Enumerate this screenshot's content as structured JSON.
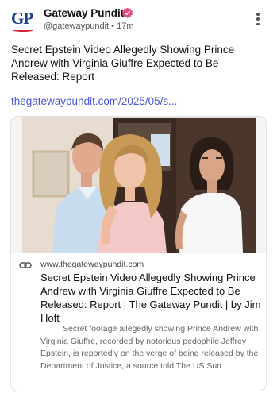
{
  "author": {
    "name": "Gateway Pundit",
    "handle": "@gatewaypundit",
    "separator": "•",
    "time": "17m",
    "avatar_text": "GP"
  },
  "post": {
    "text": "Secret Epstein Video Allegedly Showing Prince Andrew with Virginia Giuffre Expected to Be Released: Report",
    "link": "thegatewaypundit.com/2025/05/s..."
  },
  "card": {
    "domain": "www.thegatewaypundit.com",
    "title": "Secret Epstein Video Allegedly Showing Prince Andrew with Virginia Giuffre Expected to Be Released: Report | The Gateway Pundit | by Jim Hoft",
    "description": "Secret footage allegedly showing Prince Andrew with Virginia Giuffre, recorded by notorious pedophile Jeffrey Epstein, is reportedly on the verge of being released by the Department of Justice, a source told The US Sun."
  },
  "colors": {
    "link": "#4a56d6",
    "verified": "#e84a7a",
    "brand_blue": "#1c3f8f",
    "brand_red": "#d4232b"
  },
  "icons": {
    "verified": "verified-badge-icon",
    "more": "more-vertical-icon",
    "link": "link-icon"
  }
}
